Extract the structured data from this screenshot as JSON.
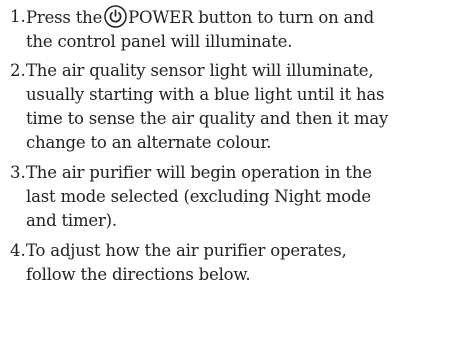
{
  "steps": [
    {
      "number": "1.",
      "text_before_icon": "Press the",
      "icon": "power-icon",
      "text_after_icon": "POWER button to turn on and",
      "lines": [
        "the control panel will illuminate."
      ]
    },
    {
      "number": "2.",
      "lines": [
        "The air quality sensor light will illuminate,",
        "usually starting with a blue light until it has",
        "time to sense the air quality and then it may",
        "change to an alternate colour."
      ]
    },
    {
      "number": "3.",
      "lines": [
        "The air purifier will begin operation in the",
        "last mode selected (excluding Night mode",
        "and timer)."
      ]
    },
    {
      "number": "4.",
      "lines": [
        "To adjust how the air purifier operates,",
        "follow the directions below."
      ]
    }
  ]
}
